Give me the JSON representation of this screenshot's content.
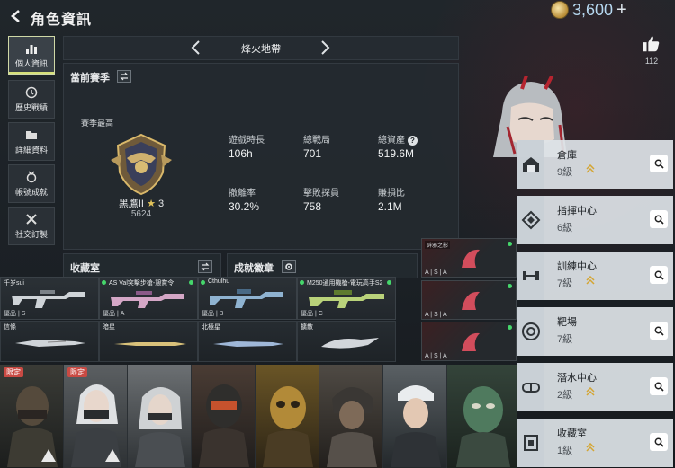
{
  "header": {
    "title": "角色資訊",
    "currency": "3,600",
    "currency_plus": "+",
    "likes": "112"
  },
  "sidebar": {
    "items": [
      {
        "label": "個人資訊",
        "icon": "bar-chart-icon",
        "active": true
      },
      {
        "label": "歷史戰績",
        "icon": "history-icon",
        "active": false
      },
      {
        "label": "詳細資料",
        "icon": "folder-icon",
        "active": false
      },
      {
        "label": "帳號成就",
        "icon": "medal-icon",
        "active": false
      },
      {
        "label": "社交訂製",
        "icon": "tools-icon",
        "active": false
      }
    ]
  },
  "season": {
    "mode_name": "烽火地帶",
    "section_label": "當前賽季",
    "best_label": "賽季最高",
    "rank_name": "黑鷹II",
    "rank_stars": "3",
    "rank_score": "5624",
    "stats": [
      {
        "label": "遊戲時長",
        "value": "106h"
      },
      {
        "label": "總戰局",
        "value": "701"
      },
      {
        "label": "總資產",
        "value": "519.6M",
        "help": "?"
      },
      {
        "label": "撤離率",
        "value": "30.2%"
      },
      {
        "label": "擊敗探員",
        "value": "758"
      },
      {
        "label": "賺損比",
        "value": "2.1M"
      }
    ]
  },
  "collection": {
    "title": "收藏室",
    "achievement_title": "成就徽章",
    "weapons": [
      {
        "name": "千岁sui",
        "grade": "優品 | S"
      },
      {
        "name": "AS Val突擊步槍-憩賞令",
        "grade": "優品 | A"
      },
      {
        "name": "Cthulhu",
        "grade": "優品 | B"
      },
      {
        "name": "M250通用機槍-電玩高手S2",
        "grade": "優品 | C"
      }
    ],
    "melee": [
      {
        "name": "信條"
      },
      {
        "name": "暗星"
      },
      {
        "name": "北極星"
      },
      {
        "name": "擴散"
      }
    ],
    "skins": [
      {
        "label": "辟邪之影",
        "grade": "A | S | A"
      },
      {
        "label": "",
        "grade": "A | S | A"
      },
      {
        "label": "",
        "grade": "A | S | A"
      }
    ]
  },
  "operators": [
    {
      "tag": "限定"
    },
    {
      "tag": "限定"
    },
    {
      "tag": ""
    },
    {
      "tag": ""
    },
    {
      "tag": ""
    },
    {
      "tag": ""
    },
    {
      "tag": ""
    },
    {
      "tag": ""
    }
  ],
  "facilities": [
    {
      "name": "倉庫",
      "level": "9級",
      "icon": "warehouse-icon",
      "upgrade": true
    },
    {
      "name": "指揮中心",
      "level": "6級",
      "icon": "command-center-icon",
      "upgrade": false
    },
    {
      "name": "訓練中心",
      "level": "7級",
      "icon": "dumbbell-icon",
      "upgrade": true
    },
    {
      "name": "靶場",
      "level": "7級",
      "icon": "target-icon",
      "upgrade": false
    },
    {
      "name": "潛水中心",
      "level": "2級",
      "icon": "goggles-icon",
      "upgrade": true
    },
    {
      "name": "收藏室",
      "level": "1級",
      "icon": "trophy-icon",
      "upgrade": true
    }
  ],
  "colors": {
    "accent_green": "#45d66b",
    "upgrade_gold": "#d4a532",
    "limited_red": "#c94a43"
  }
}
